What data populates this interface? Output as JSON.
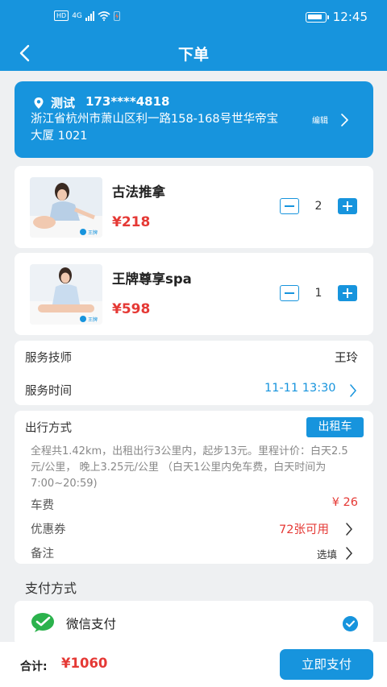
{
  "status_bar": {
    "network_badge": "HD",
    "network_type": "4G",
    "time": "12:45"
  },
  "nav": {
    "title": "下单",
    "back_icon": "chevron-left-icon"
  },
  "address": {
    "name": "测试",
    "phone": "173****4818",
    "line": "浙江省杭州市萧山区利一路158-168号世华帝宝大厦 1021",
    "edit_label": "编辑"
  },
  "items": [
    {
      "name": "古法推拿",
      "price": "¥218",
      "qty": "2",
      "thumb_badge": "王牌"
    },
    {
      "name": "王牌尊享spa",
      "price": "¥598",
      "qty": "1",
      "thumb_badge": "王牌"
    }
  ],
  "service": {
    "tech_label": "服务技师",
    "tech_value": "王玲",
    "time_label": "服务时间",
    "time_value": "11-11 13:30"
  },
  "travel": {
    "label": "出行方式",
    "mode": "出租车",
    "description": "全程共1.42km，出租出行3公里内，起步13元。里程计价：白天2.5元/公里， 晚上3.25元/公里 （白天1公里内免车费，白天时间为7:00~20:59)",
    "fare_label": "车费",
    "fare_value": "¥ 26",
    "coupon_label": "优惠券",
    "coupon_value": "72张可用",
    "remark_label": "备注",
    "remark_value": "选填"
  },
  "payment": {
    "title": "支付方式",
    "method": "微信支付",
    "selected": true
  },
  "footer": {
    "total_label": "合计:",
    "total_value": "¥1060",
    "pay_button": "立即支付"
  },
  "colors": {
    "primary": "#1794dd",
    "price_red": "#e53935",
    "background": "#eef0f2"
  }
}
